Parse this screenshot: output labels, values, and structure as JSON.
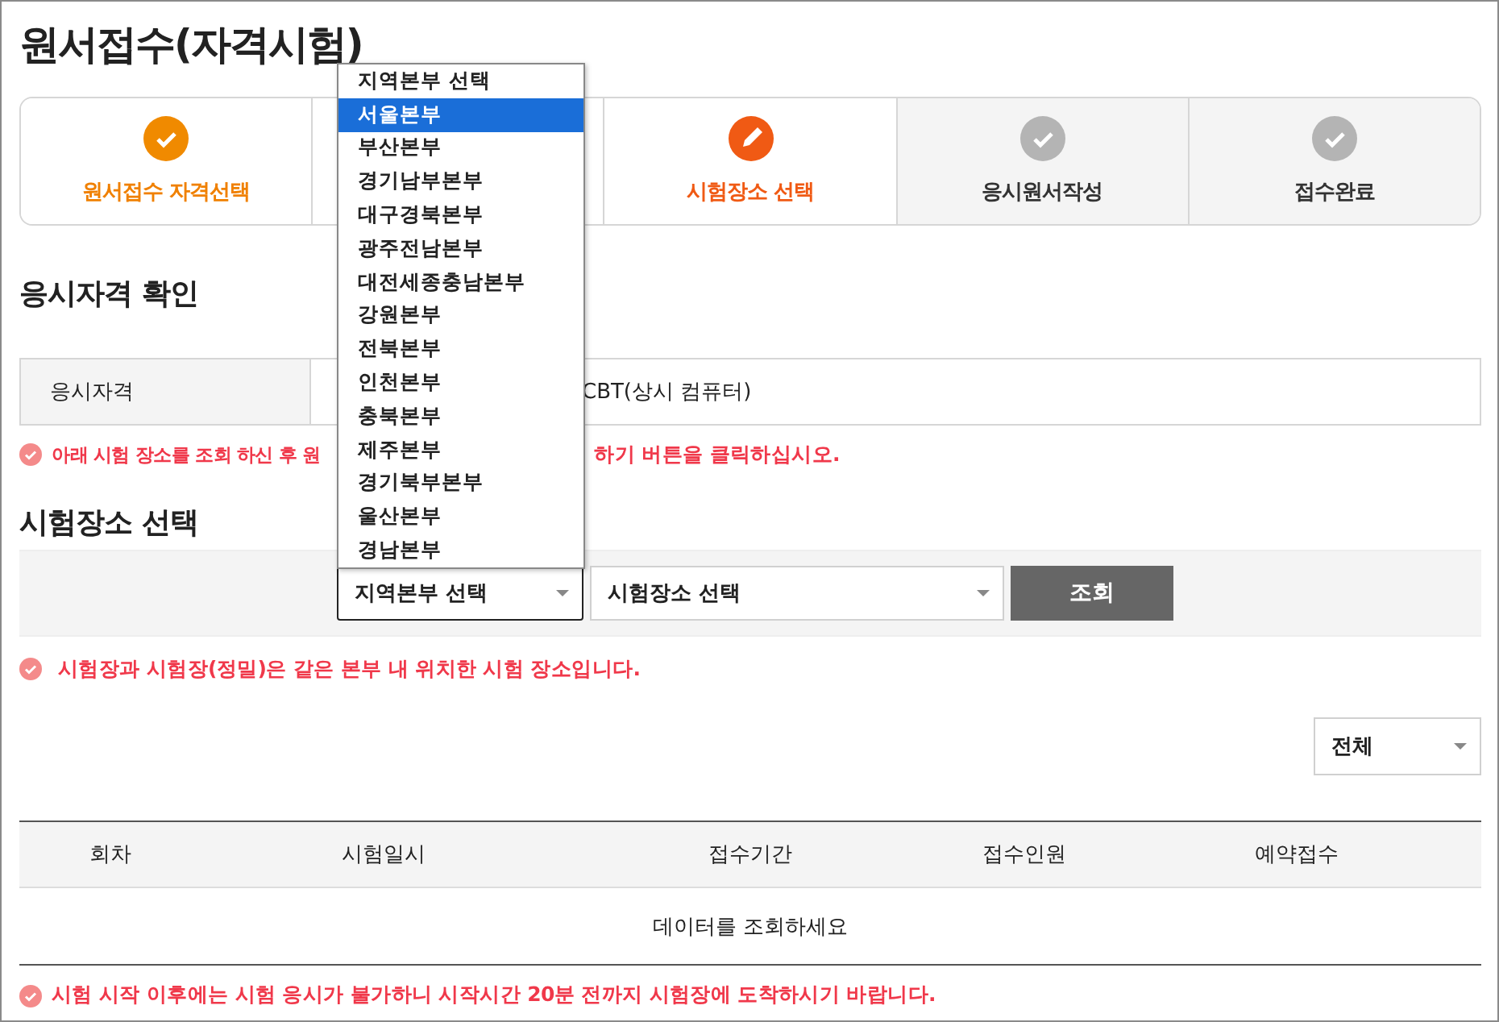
{
  "page": {
    "title": "원서접수(자격시험)"
  },
  "steps": [
    {
      "label": "원서접수 자격선택",
      "kind": "done"
    },
    {
      "kind": "done"
    },
    {
      "label": "시험장소 선택",
      "kind": "current"
    },
    {
      "label": "응시원서작성",
      "kind": "todo"
    },
    {
      "label": "접수완료",
      "kind": "todo"
    }
  ],
  "qualification": {
    "heading": "응시자격 확인",
    "label": "응시자격",
    "value": "CBT(상시 컴퓨터)",
    "notice_start": "아래 시험 장소를 조회 하신 후 원",
    "notice_end": "하기 버튼을 클릭하십시오."
  },
  "venue": {
    "heading": "시험장소 선택",
    "region_select": {
      "value": "지역본부 선택",
      "focused": true,
      "open": true,
      "options": [
        {
          "label": "지역본부 선택",
          "highlighted": false
        },
        {
          "label": "서울본부",
          "highlighted": true
        },
        {
          "label": "부산본부",
          "highlighted": false
        },
        {
          "label": "경기남부본부",
          "highlighted": false
        },
        {
          "label": "대구경북본부",
          "highlighted": false
        },
        {
          "label": "광주전남본부",
          "highlighted": false
        },
        {
          "label": "대전세종충남본부",
          "highlighted": false
        },
        {
          "label": "강원본부",
          "highlighted": false
        },
        {
          "label": "전북본부",
          "highlighted": false
        },
        {
          "label": "인천본부",
          "highlighted": false
        },
        {
          "label": "충북본부",
          "highlighted": false
        },
        {
          "label": "제주본부",
          "highlighted": false
        },
        {
          "label": "경기북부본부",
          "highlighted": false
        },
        {
          "label": "울산본부",
          "highlighted": false
        },
        {
          "label": "경남본부",
          "highlighted": false
        }
      ]
    },
    "place_select": {
      "value": "시험장소 선택"
    },
    "search_button": "조회",
    "notice": "시험장과 시험장(정밀)은 같은 본부 내 위치한 시험 장소입니다."
  },
  "filter": {
    "value": "전체"
  },
  "table": {
    "columns": [
      "회차",
      "시험일시",
      "접수기간",
      "접수인원",
      "예약접수"
    ],
    "empty_message": "데이터를 조회하세요"
  },
  "footer_notice": "시험 시작 이후에는 시험 응시가 불가하니 시작시간 20분 전까지 시험장에 도착하시기 바랍니다."
}
